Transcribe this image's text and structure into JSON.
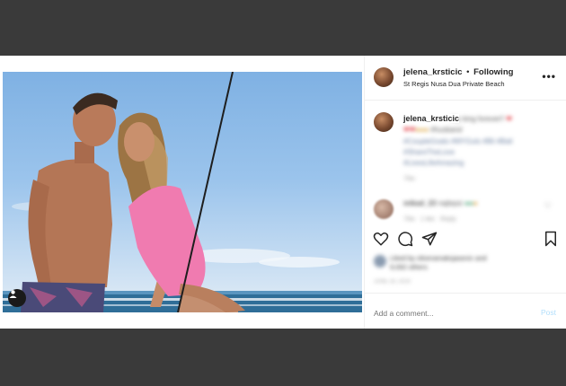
{
  "header": {
    "username": "jelena_krsticic",
    "separator": "•",
    "follow_status": "Following",
    "location": "St Regis Nusa Dua Private Beach",
    "more_label": "•••"
  },
  "caption": {
    "username": "jelena_krsticic",
    "text_line1": "My king forever!!",
    "text_line2": "#husband",
    "text_line3": "#CoupleGoals #MYGuls #Bli #Bali",
    "text_line4": "#ShareTheLove",
    "text_line5": "#LivesLifeAmazing",
    "time": "79w"
  },
  "comment": {
    "username": "mikad_23",
    "text": "najlepsi",
    "time": "79w",
    "likes": "1 like",
    "reply": "Reply"
  },
  "stats": {
    "liked_by_line1": "Liked by oliveramaksjasevic and",
    "liked_by_line2": "9,092 others",
    "date": "JUNE 16, 2019"
  },
  "comment_box": {
    "placeholder": "Add a comment...",
    "post_label": "Post"
  },
  "icons": [
    "heart-icon",
    "comment-icon",
    "share-icon",
    "bookmark-icon",
    "tag-person-icon",
    "more-icon"
  ],
  "colors": {
    "post_link": "#b2dffc",
    "heart": "#e0323a",
    "text": "#262626"
  }
}
